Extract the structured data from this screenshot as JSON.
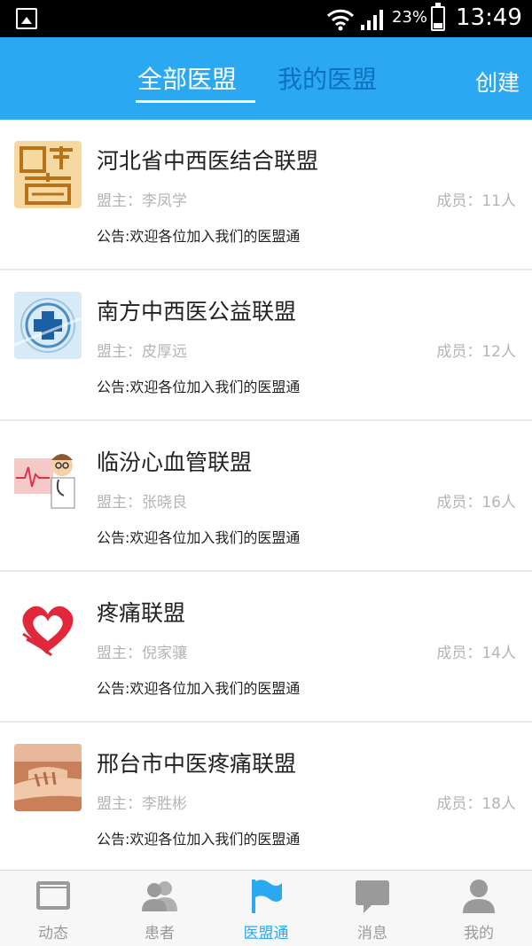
{
  "status_bar": {
    "battery_percent": "23%",
    "time": "13:49"
  },
  "header": {
    "tabs": [
      {
        "label": "全部医盟",
        "active": true
      },
      {
        "label": "我的医盟",
        "active": false
      }
    ],
    "create_label": "创建",
    "accent_color": "#2aa9f2"
  },
  "alliances": [
    {
      "name": "河北省中西医结合联盟",
      "owner": "盟主：李凤学",
      "members": "成员：11人",
      "notice": "公告:欢迎各位加入我们的医盟通",
      "avatar_icon": "medicine-character-icon"
    },
    {
      "name": "南方中西医公益联盟",
      "owner": "盟主：皮厚远",
      "members": "成员：12人",
      "notice": "公告:欢迎各位加入我们的医盟通",
      "avatar_icon": "medical-cross-icon"
    },
    {
      "name": "临汾心血管联盟",
      "owner": "盟主：张晓良",
      "members": "成员：16人",
      "notice": "公告:欢迎各位加入我们的医盟通",
      "avatar_icon": "doctor-cardio-icon"
    },
    {
      "name": "疼痛联盟",
      "owner": "盟主：倪家骧",
      "members": "成员：14人",
      "notice": "公告:欢迎各位加入我们的医盟通",
      "avatar_icon": "heart-hands-icon"
    },
    {
      "name": "邢台市中医疼痛联盟",
      "owner": "盟主：李胜彬",
      "members": "成员：18人",
      "notice": "公告:欢迎各位加入我们的医盟通",
      "avatar_icon": "pulse-diagnosis-icon"
    }
  ],
  "bottom_nav": [
    {
      "label": "动态",
      "icon": "feed-icon",
      "active": false
    },
    {
      "label": "患者",
      "icon": "patients-icon",
      "active": false
    },
    {
      "label": "医盟通",
      "icon": "flag-icon",
      "active": true
    },
    {
      "label": "消息",
      "icon": "message-icon",
      "active": false
    },
    {
      "label": "我的",
      "icon": "profile-icon",
      "active": false
    }
  ]
}
